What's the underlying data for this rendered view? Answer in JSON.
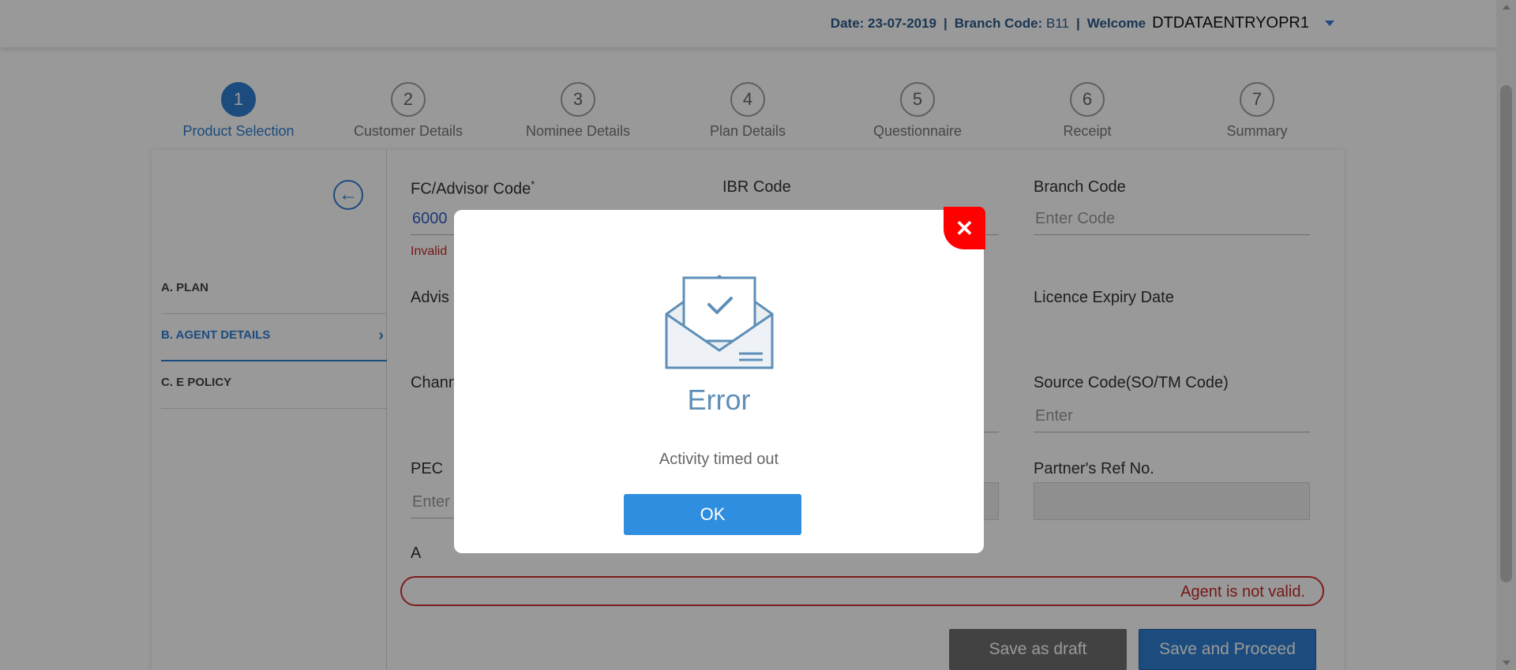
{
  "header": {
    "date_label": "Date:",
    "date_value": "23-07-2019",
    "separator": "|",
    "branch_label": "Branch Code:",
    "branch_value": "B11",
    "welcome_label": "Welcome",
    "username": "DTDATAENTRYOPR1"
  },
  "steps": [
    {
      "number": "1",
      "label": "Product Selection",
      "active": true
    },
    {
      "number": "2",
      "label": "Customer Details"
    },
    {
      "number": "3",
      "label": "Nominee Details"
    },
    {
      "number": "4",
      "label": "Plan Details"
    },
    {
      "number": "5",
      "label": "Questionnaire"
    },
    {
      "number": "6",
      "label": "Receipt"
    },
    {
      "number": "7",
      "label": "Summary"
    }
  ],
  "sidebar": {
    "items": [
      {
        "label": "A. PLAN"
      },
      {
        "label": "B. AGENT DETAILS",
        "active": true
      },
      {
        "label": "C. E POLICY"
      }
    ]
  },
  "form": {
    "fc_label": "FC/Advisor Code",
    "fc_required": "*",
    "fc_value": "6000",
    "fc_error": "Invalid",
    "ibr_label": "IBR Code",
    "branch_code_label": "Branch Code",
    "branch_code_placeholder": "Enter Code",
    "advisor_label": "Advis",
    "licence_label": "Licence Expiry Date",
    "channel_label": "Chann",
    "source_label": "Source Code(SO/TM Code)",
    "source_placeholder": "Enter",
    "pec_label": "PEC",
    "pec_placeholder": "Enter",
    "partner_label": "Partner's Ref No.",
    "partial_label": "A"
  },
  "alert": {
    "text": "Agent is not valid."
  },
  "buttons": {
    "save_draft": "Save as draft",
    "save_proceed": "Save and Proceed"
  },
  "modal": {
    "title": "Error",
    "message": "Activity timed out",
    "ok_label": "OK",
    "close_glyph": "✕",
    "icon": "envelope-check-icon"
  },
  "colors": {
    "accent": "#2f7fd1",
    "error": "#d32f2f",
    "close": "#ff0000",
    "modal_title": "#5e8fb8"
  }
}
